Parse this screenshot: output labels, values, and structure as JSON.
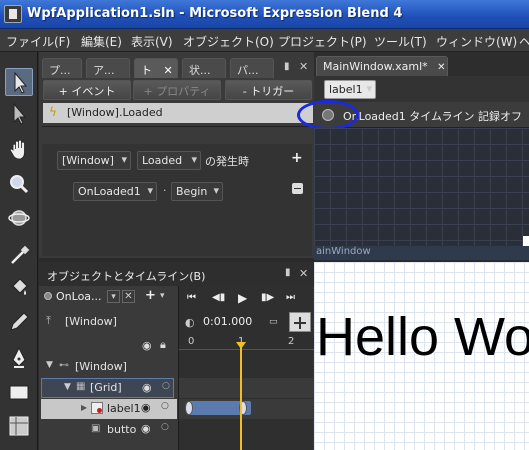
{
  "window": {
    "title": "WpfApplication1.sln - Microsoft Expression Blend 4"
  },
  "menubar": {
    "items": [
      "ファイル(F)",
      "編集(E)",
      "表示(V)",
      "オブジェクト(O)",
      "プロジェクト(P)",
      "ツール(T)",
      "ウィンドウ(W)",
      "ヘ"
    ]
  },
  "panel_tabs": [
    "プ...",
    "ア...",
    "ト",
    "状...",
    "パ..."
  ],
  "triggers": {
    "add_event": "+ イベント",
    "add_property": "+ プロパティ",
    "remove_trigger": "- トリガー",
    "event_item": "[Window].Loaded",
    "source_combo": "[Window]",
    "event_combo": "Loaded",
    "when_text": "の発生時",
    "storyboard_combo": "OnLoaded1",
    "dot": "·",
    "action_combo": "Begin"
  },
  "objects": {
    "title": "オブジェクトとタイムライン(B)",
    "storyboard_name": "OnLoa...",
    "scope": "[Window]",
    "time": "0:01.000",
    "ruler": [
      "0",
      "1",
      "2"
    ],
    "tree": [
      {
        "label": "[Window]"
      },
      {
        "label": "[Grid]"
      },
      {
        "label": "label1"
      },
      {
        "label": "butto"
      }
    ]
  },
  "document": {
    "tab_label": "MainWindow.xaml*",
    "element_combo": "label1",
    "recording_text": "OnLoaded1 タイムライン 記録オフ",
    "artboard_label": "ainWindow",
    "content_text": "Hello Wo"
  },
  "colors": {
    "title_bar": "#1f4fb8",
    "annotation": "#1a2adf",
    "playhead": "#f0c020"
  }
}
